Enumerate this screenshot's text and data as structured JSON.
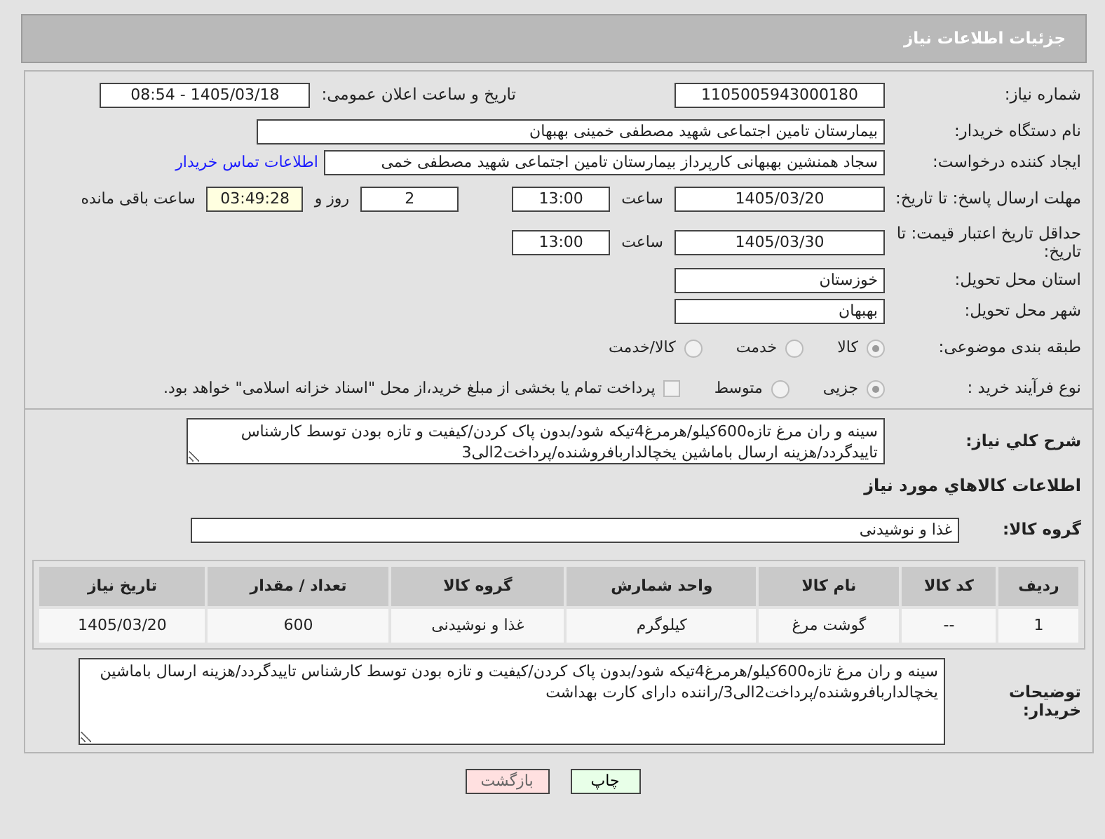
{
  "header": {
    "title": "جزئیات اطلاعات نیاز"
  },
  "need_number": {
    "label": "شماره نیاز:",
    "value": "1105005943000180"
  },
  "announce": {
    "label": "تاریخ و ساعت اعلان عمومی:",
    "value": "1405/03/18 - 08:54"
  },
  "buyer": {
    "label": "نام دستگاه خریدار:",
    "value": "بیمارستان تامین اجتماعی شهید مصطفی خمینی بهبهان"
  },
  "requester": {
    "label": "ایجاد کننده درخواست:",
    "value": "سجاد همنشین بهبهانی کارپرداز بیمارستان تامین اجتماعی شهید مصطفی خمی",
    "link": "اطلاعات تماس خریدار"
  },
  "reply_deadline": {
    "label": "مهلت ارسال پاسخ: تا تاریخ:",
    "date": "1405/03/20",
    "time_label": "ساعت",
    "time": "13:00",
    "days": "2",
    "days_label": "روز و",
    "remaining": "03:49:28",
    "remaining_label": "ساعت باقی مانده"
  },
  "price_validity": {
    "label": "حداقل تاریخ اعتبار قیمت: تا تاریخ:",
    "date": "1405/03/30",
    "time_label": "ساعت",
    "time": "13:00"
  },
  "province": {
    "label": "استان محل تحویل:",
    "value": "خوزستان"
  },
  "city": {
    "label": "شهر محل تحویل:",
    "value": "بهبهان"
  },
  "category": {
    "label": "طبقه بندی موضوعی:",
    "options": [
      {
        "label": "کالا",
        "selected": true
      },
      {
        "label": "خدمت",
        "selected": false
      },
      {
        "label": "کالا/خدمت",
        "selected": false
      }
    ]
  },
  "process": {
    "label": "نوع فرآیند خرید :",
    "options": [
      {
        "label": "جزیی",
        "selected": true
      },
      {
        "label": "متوسط",
        "selected": false
      }
    ],
    "payment": {
      "checked": false,
      "text": "پرداخت تمام یا بخشی از مبلغ خرید،از محل \"اسناد خزانه اسلامی\" خواهد بود."
    }
  },
  "description": {
    "label": "شرح کلي نیاز:",
    "value": "سینه و ران مرغ تازه600کیلو/هرمرغ4تیکه شود/بدون پاک کردن/کیفیت و تازه بودن توسط کارشناس تاییدگردد/هزینه ارسال باماشین یخچالداربافروشنده/پرداخت2الی3"
  },
  "goods_heading": "اطلاعات کالاهاي مورد نیاز",
  "goods_group": {
    "label": "گروه کالا:",
    "value": "غذا و نوشیدنی"
  },
  "table": {
    "columns": [
      "ردیف",
      "کد کالا",
      "نام کالا",
      "واحد شمارش",
      "گروه کالا",
      "تعداد / مقدار",
      "تاریخ نیاز"
    ],
    "rows": [
      [
        "1",
        "--",
        "گوشت مرغ",
        "کیلوگرم",
        "غذا و نوشیدنی",
        "600",
        "1405/03/20"
      ]
    ]
  },
  "buyer_notes": {
    "label": "توضیحات خریدار:",
    "value": "سینه و ران مرغ تازه600کیلو/هرمرغ4تیکه شود/بدون پاک کردن/کیفیت و تازه بودن توسط کارشناس تاییدگردد/هزینه ارسال باماشین یخچالداربافروشنده/پرداخت2الی3/راننده دارای کارت بهداشت"
  },
  "buttons": [
    {
      "label": "چاپ",
      "kind": "print"
    },
    {
      "label": "بازگشت",
      "kind": "back"
    }
  ]
}
